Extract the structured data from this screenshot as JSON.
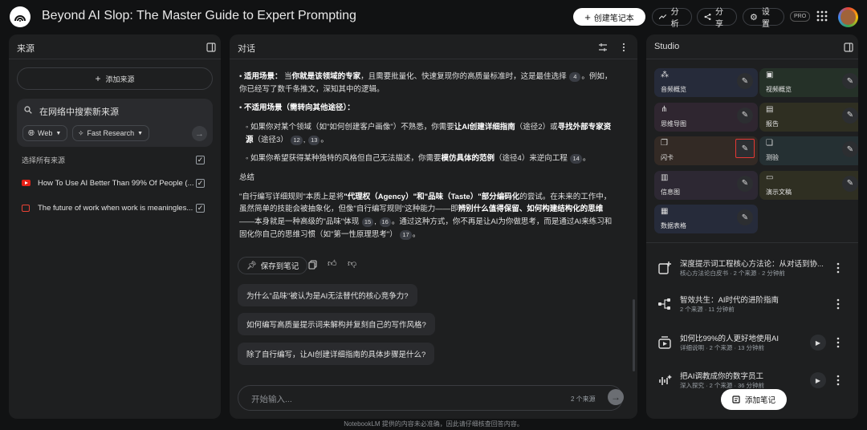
{
  "app": {
    "title": "Beyond AI Slop: The Master Guide to Expert Prompting"
  },
  "topbar": {
    "create_notebook": "创建笔记本",
    "analytics": "分析",
    "share": "分享",
    "settings": "设置",
    "badge": "PRO"
  },
  "sources": {
    "header": "来源",
    "add_label": "添加来源",
    "search_placeholder": "在网络中搜索新来源",
    "chip_web": "Web",
    "chip_research": "Fast Research",
    "select_all": "选择所有来源",
    "items": [
      {
        "label": "How To Use AI Better Than 99% Of People (..."
      },
      {
        "label": "The future of work when work is meaningles..."
      }
    ]
  },
  "chat": {
    "header": "对话",
    "p1_label": "适用场景：",
    "p1_a": "当",
    "p1_b": "你就是该领域的专家",
    "p1_c": "，且需要批量化、快速复现你的高质量标准时，这是最佳选择",
    "p1_cite": "4",
    "p1_d": "。例如，你已经写了数千条推文，深知其中的逻辑。",
    "p2_label": "不适用场景（需转向其他途径）：",
    "p3_a": "◦ 如果你对某个领域（如\"如何创建客户画像\"）不熟悉，你需要",
    "p3_b": "让AI创建详细指南",
    "p3_c": "（途径2）或",
    "p3_d": "寻找外部专家资源",
    "p3_e": "（途径3）",
    "p3_cite1": "12",
    "p3_cite2": "13",
    "p4_a": "◦ 如果你希望获得某种独特的风格但自己无法描述，你需要",
    "p4_b": "模仿具体的范例",
    "p4_c": "（途径4）来逆向工程",
    "p4_cite": "14",
    "summary_title": "总结",
    "s_a": "\"自行编写详细规则\"本质上是将",
    "s_b": "\"代理权（Agency）\"和\"品味（Taste）\"部分编码化",
    "s_c": "的尝试。在未来的工作中，虽然简单的技能会被抽象化，但像\"自行编写规则\"这种能力——即",
    "s_d": "辨别什么值得保留、如何构建结构化的思维",
    "s_e": "——本身就是一种高级的\"品味\"体现",
    "s_cite1": "15",
    "s_cite2": "16",
    "s_f": "。通过这种方式，你不再是让AI为你做思考，而是通过AI来练习和固化你自己的思维习惯（如\"第一性原理思考\"）",
    "s_cite3": "17",
    "save_note": "保存到笔记",
    "suggestions": [
      "为什么\"品味\"被认为是AI无法替代的核心竞争力?",
      "如何编写高质量提示词来解构并复刻自己的写作风格?",
      "除了自行编写，让AI创建详细指南的具体步骤是什么?"
    ],
    "input_placeholder": "开始输入...",
    "source_count": "2 个来源"
  },
  "studio": {
    "header": "Studio",
    "tiles": [
      {
        "label": "音频概览",
        "bg": "#262b3a"
      },
      {
        "label": "视频概览",
        "bg": "#253128"
      },
      {
        "label": "思维导图",
        "bg": "#2f2630"
      },
      {
        "label": "报告",
        "bg": "#2f2f22"
      },
      {
        "label": "闪卡",
        "bg": "#332a25"
      },
      {
        "label": "测验",
        "bg": "#253033"
      },
      {
        "label": "信息图",
        "bg": "#2d2833"
      },
      {
        "label": "演示文稿",
        "bg": "#2f2f22"
      },
      {
        "label": "数据表格",
        "bg": "#262b3a"
      }
    ],
    "notes": [
      {
        "title": "深度提示词工程核心方法论：从对话到协...",
        "meta": "核心方法论白皮书 · 2 个来源 · 2 分钟前"
      },
      {
        "title": "智效共生：AI时代的进阶指南",
        "meta": "2 个来源 · 11 分钟前"
      },
      {
        "title": "如何比99%的人更好地使用AI",
        "meta": "详细说明 · 2 个来源 · 13 分钟前"
      },
      {
        "title": "把AI调教成你的数字员工",
        "meta": "深入探究 · 2 个来源 · 36 分钟前"
      }
    ],
    "add_note": "添加笔记"
  },
  "footer": {
    "text": "NotebookLM 提供的内容未必准确，因此请仔细核查回答内容。"
  }
}
